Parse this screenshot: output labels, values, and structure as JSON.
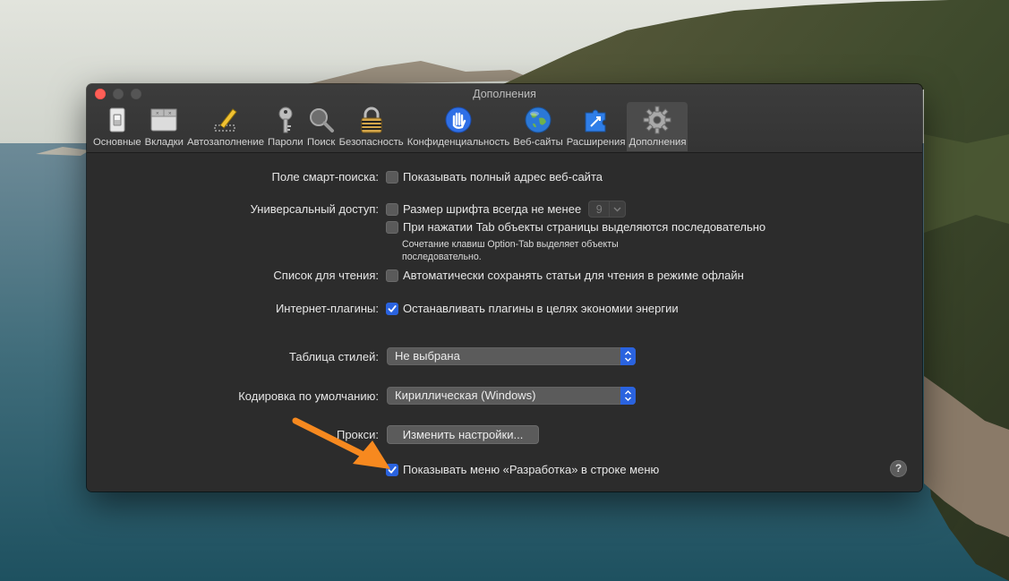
{
  "window": {
    "title": "Дополнения"
  },
  "tabs": [
    {
      "label": "Основные",
      "icon": "switch-icon"
    },
    {
      "label": "Вкладки",
      "icon": "tabs-icon"
    },
    {
      "label": "Автозаполнение",
      "icon": "pencil-icon"
    },
    {
      "label": "Пароли",
      "icon": "key-icon"
    },
    {
      "label": "Поиск",
      "icon": "magnifier-icon"
    },
    {
      "label": "Безопасность",
      "icon": "padlock-icon"
    },
    {
      "label": "Конфиденциальность",
      "icon": "hand-icon"
    },
    {
      "label": "Веб-сайты",
      "icon": "globe-icon"
    },
    {
      "label": "Расширения",
      "icon": "puzzle-icon"
    },
    {
      "label": "Дополнения",
      "icon": "gear-icon",
      "active": true
    }
  ],
  "settings": {
    "smart_search": {
      "label": "Поле смарт-поиска:",
      "option": "Показывать полный адрес веб-сайта",
      "checked": false
    },
    "accessibility": {
      "label": "Универсальный доступ:",
      "font_option": "Размер шрифта всегда не менее",
      "font_size": "9",
      "font_checked": false,
      "tab_option": "При нажатии Tab объекты страницы выделяются последовательно",
      "tab_checked": false,
      "tab_note": "Сочетание клавиш Option-Tab выделяет объекты последовательно."
    },
    "reading_list": {
      "label": "Список для чтения:",
      "option": "Автоматически сохранять статьи для чтения в режиме офлайн",
      "checked": false
    },
    "plugins": {
      "label": "Интернет-плагины:",
      "option": "Останавливать плагины в целях экономии энергии",
      "checked": true
    },
    "stylesheet": {
      "label": "Таблица стилей:",
      "value": "Не выбрана"
    },
    "encoding": {
      "label": "Кодировка по умолчанию:",
      "value": "Кириллическая (Windows)"
    },
    "proxies": {
      "label": "Прокси:",
      "button": "Изменить настройки..."
    },
    "develop_menu": {
      "option": "Показывать меню «Разработка» в строке меню",
      "checked": true
    },
    "help": "?"
  },
  "colors": {
    "accent": "#2a63df",
    "arrow": "#f7891f",
    "close": "#ff5f57"
  }
}
